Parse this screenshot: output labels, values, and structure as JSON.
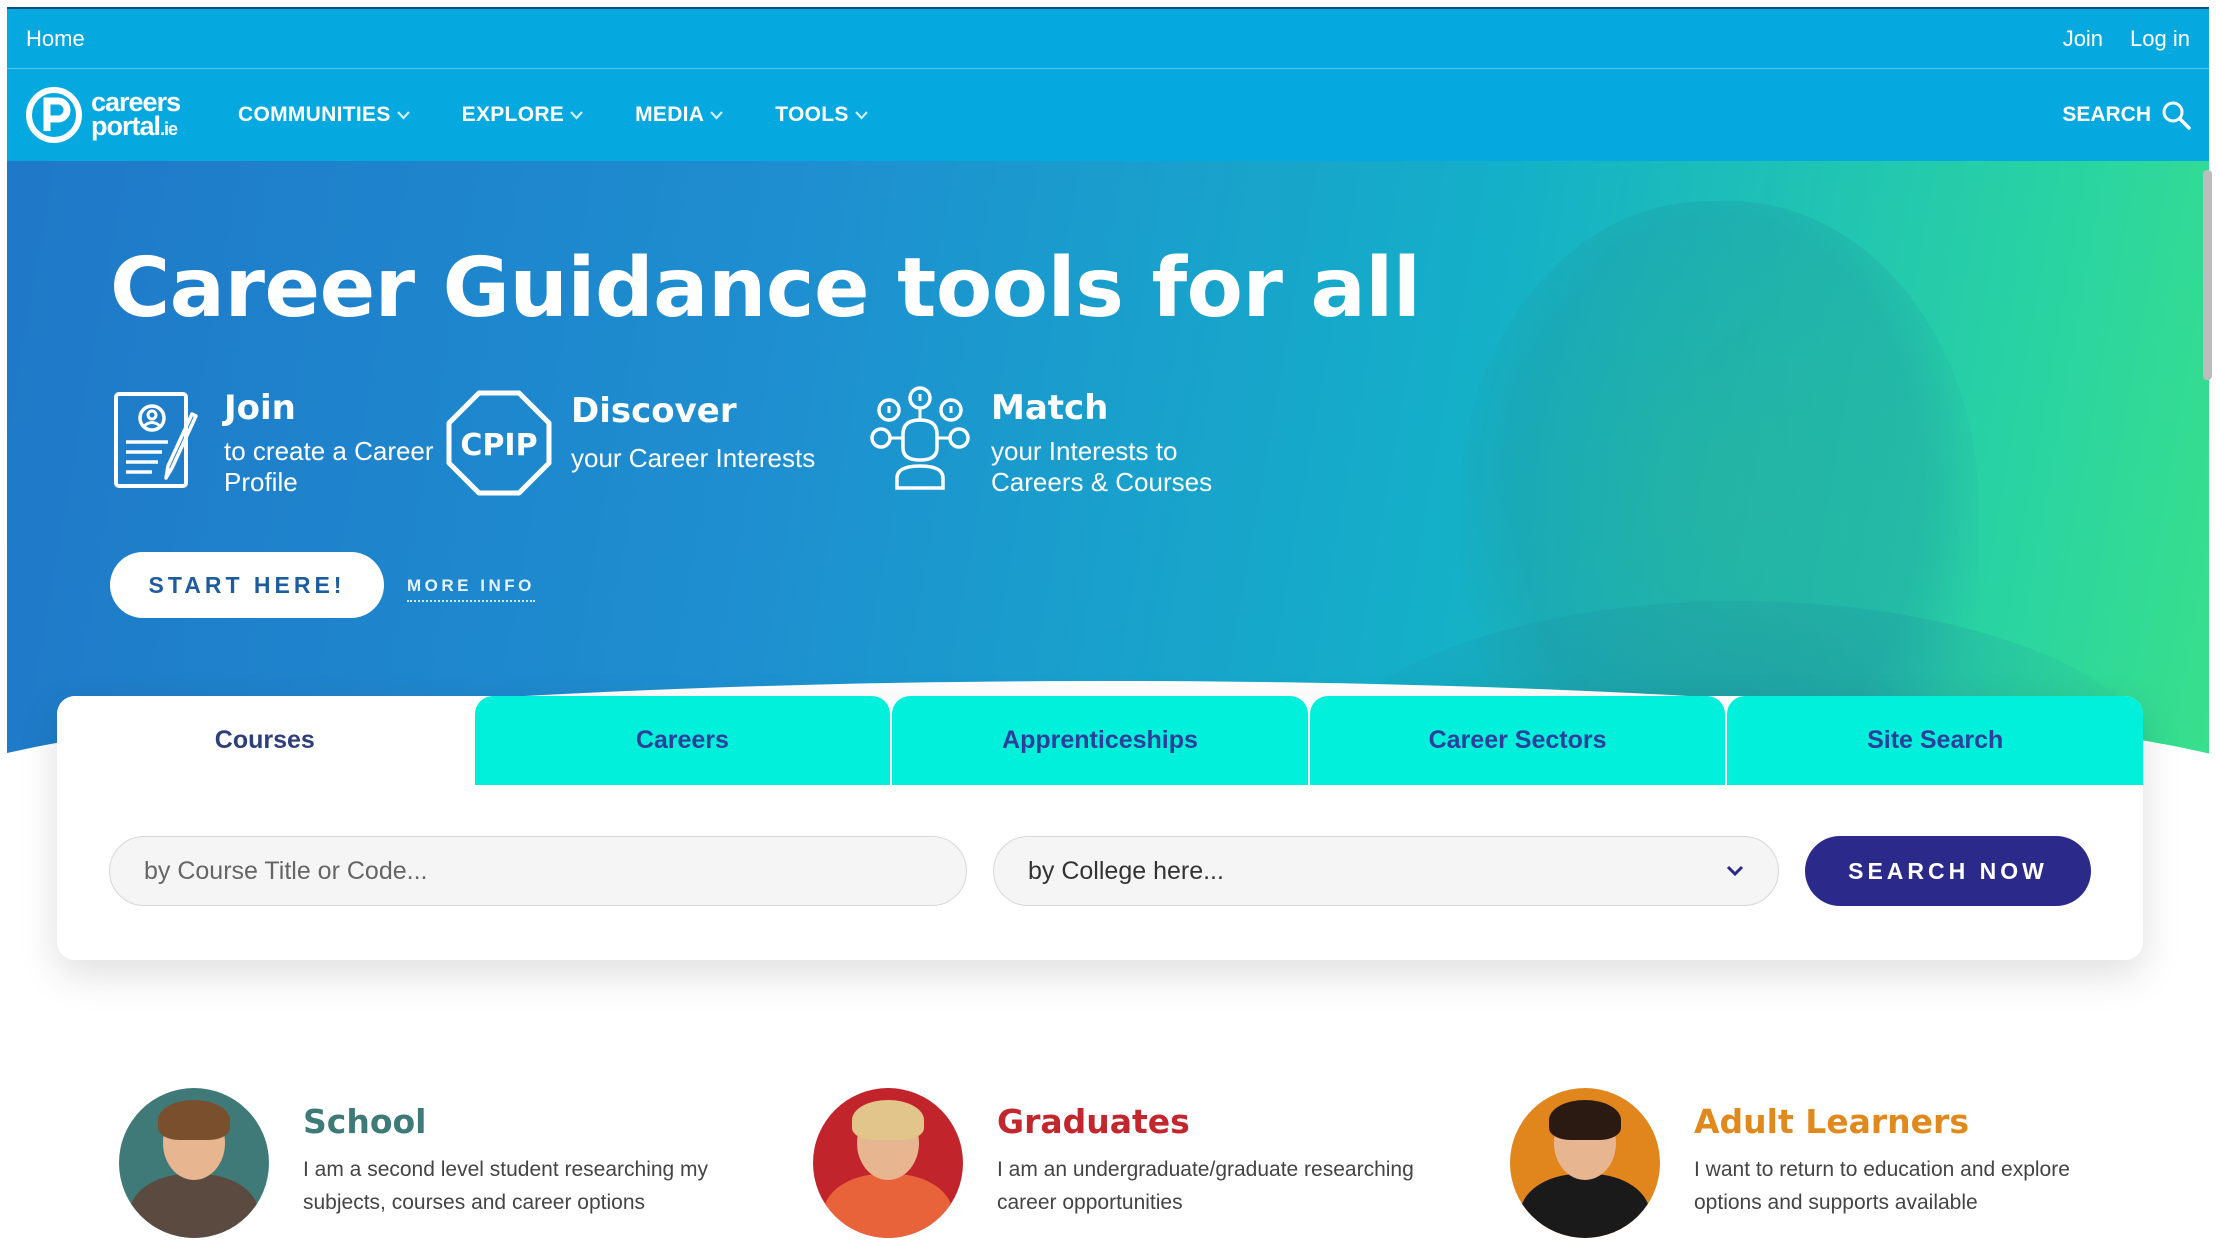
{
  "topbar": {
    "home": "Home",
    "join": "Join",
    "login": "Log in"
  },
  "logo": {
    "line1": "careers",
    "line2": "portal",
    "suffix": ".ie"
  },
  "nav": {
    "items": [
      {
        "label": "COMMUNITIES"
      },
      {
        "label": "EXPLORE"
      },
      {
        "label": "MEDIA"
      },
      {
        "label": "TOOLS"
      }
    ],
    "search": "SEARCH"
  },
  "hero": {
    "title": "Career Guidance tools for all",
    "features": [
      {
        "title": "Join",
        "sub": "to create a Career Profile"
      },
      {
        "title": "Discover",
        "sub": "your Career Interests",
        "badge": "CPIP"
      },
      {
        "title": "Match",
        "sub": "your Interests to Careers & Courses"
      }
    ],
    "start": "START HERE!",
    "more": "MORE INFO"
  },
  "search": {
    "tabs": [
      "Courses",
      "Careers",
      "Apprenticeships",
      "Career Sectors",
      "Site Search"
    ],
    "active_tab": "Courses",
    "course_placeholder": "by Course Title or Code...",
    "college_value": "by College here...",
    "button": "SEARCH NOW"
  },
  "audiences": [
    {
      "title": "School",
      "desc": "I am a second level student researching my subjects, courses and career options"
    },
    {
      "title": "Graduates",
      "desc": "I am an undergraduate/graduate researching career opportunities"
    },
    {
      "title": "Adult Learners",
      "desc": "I want to return to education and explore options and supports available"
    }
  ],
  "colors": {
    "brand_blue": "#05a9e0",
    "tab_cyan": "#00f0dc",
    "button_navy": "#2b2a8a",
    "school": "#3d7a78",
    "graduates": "#c1272d",
    "adult": "#e08a1e"
  },
  "icons": {
    "search": "search-icon",
    "chevron": "chevron-down-icon",
    "join": "profile-form-icon",
    "discover": "cpip-octagon-icon",
    "match": "match-network-icon"
  }
}
